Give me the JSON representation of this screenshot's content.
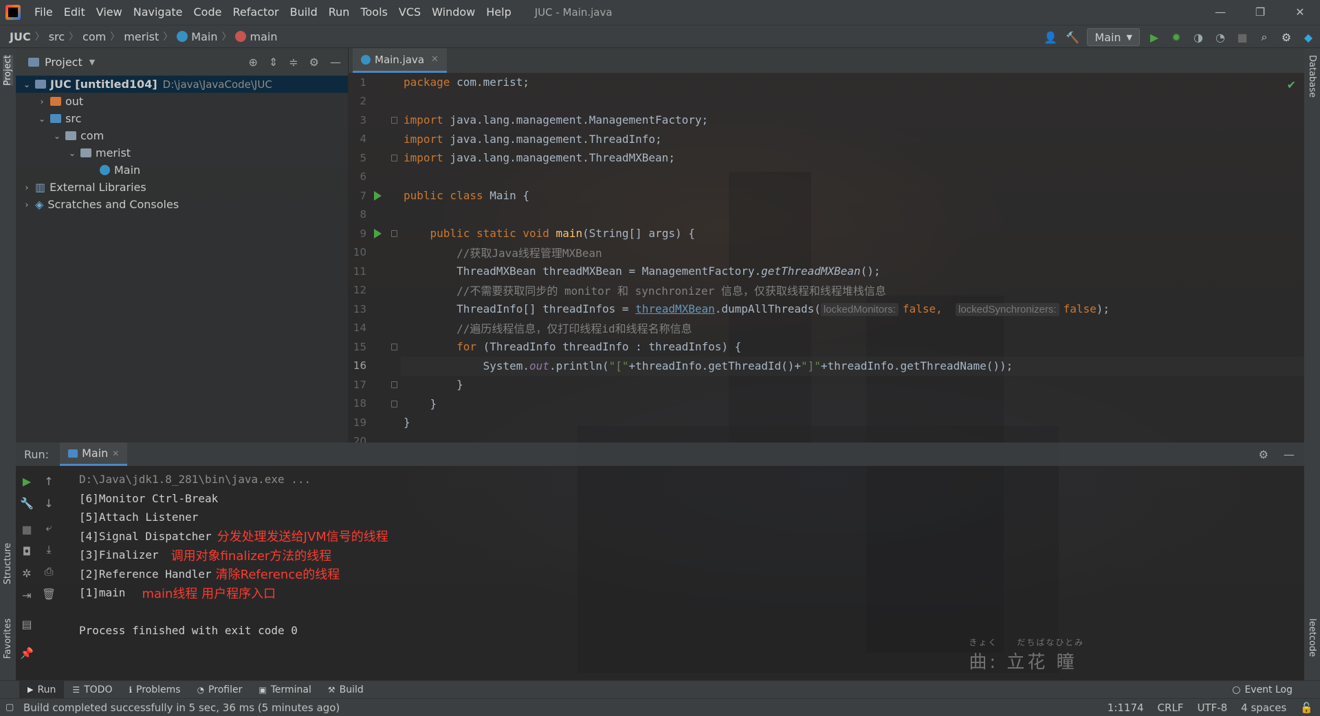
{
  "window": {
    "title": "JUC - Main.java",
    "menu": [
      "File",
      "Edit",
      "View",
      "Navigate",
      "Code",
      "Refactor",
      "Build",
      "Run",
      "Tools",
      "VCS",
      "Window",
      "Help"
    ],
    "controls": [
      "—",
      "❐",
      "✕"
    ]
  },
  "breadcrumb": [
    "JUC",
    "src",
    "com",
    "merist",
    "Main",
    "main"
  ],
  "toolbar": {
    "run_config": "Main"
  },
  "project": {
    "header": "Project",
    "tree": [
      {
        "label": "JUC [untitled104]",
        "path": "D:\\java\\JavaCode\\JUC"
      },
      {
        "label": "out",
        "path": ""
      },
      {
        "label": "src",
        "path": ""
      },
      {
        "label": "com",
        "path": ""
      },
      {
        "label": "merist",
        "path": ""
      },
      {
        "label": "Main",
        "path": ""
      },
      {
        "label": "External Libraries",
        "path": ""
      },
      {
        "label": "Scratches and Consoles",
        "path": ""
      }
    ]
  },
  "editor": {
    "tab": "Main.java",
    "line_numbers": [
      "1",
      "2",
      "3",
      "4",
      "5",
      "6",
      "7",
      "8",
      "9",
      "10",
      "11",
      "12",
      "13",
      "14",
      "15",
      "16",
      "17",
      "18",
      "19",
      "20"
    ],
    "current_line": "16",
    "lines": {
      "l1a": "package",
      "l1b": " com.merist;",
      "l3a": "import",
      "l3b": " java.lang.management.ManagementFactory;",
      "l4a": "import",
      "l4b": " java.lang.management.ThreadInfo;",
      "l5a": "import",
      "l5b": " java.lang.management.ThreadMXBean;",
      "l7a": "public class",
      "l7b": " Main {",
      "l9a": "    public static void",
      "l9b": " main",
      "l9c": "(String[] args) {",
      "l10": "        //获取Java线程管理MXBean",
      "l11a": "        ThreadMXBean threadMXBean = ManagementFactory.",
      "l11b": "getThreadMXBean",
      "l11c": "();",
      "l12": "        //不需要获取同步的 monitor 和 synchronizer 信息，仅获取线程和线程堆栈信息",
      "l13a": "        ThreadInfo[] threadInfos = ",
      "l13b": "threadMXBean",
      "l13c": ".dumpAllThreads(",
      "l13h1": "lockedMonitors:",
      "l13d": "false",
      "l13e": ",  ",
      "l13h2": "lockedSynchronizers:",
      "l13f": "false",
      "l13g": ");",
      "l14": "        //遍历线程信息，仅打印线程id和线程名称信息",
      "l15a": "        for",
      "l15b": " (ThreadInfo threadInfo : threadInfos) {",
      "l16a": "            System.",
      "l16b": "out",
      "l16c": ".println(",
      "l16d": "\"[\"",
      "l16e": "+threadInfo.getThreadId()+",
      "l16f": "\"]\"",
      "l16g": "+threadInfo.getThreadName());",
      "l17": "        }",
      "l18": "    }",
      "l19": "}"
    }
  },
  "run": {
    "label": "Run:",
    "tab": "Main",
    "console": [
      {
        "text": "D:\\Java\\jdk1.8_281\\bin\\java.exe ...",
        "note": ""
      },
      {
        "text": "[6]Monitor Ctrl-Break",
        "note": ""
      },
      {
        "text": "[5]Attach Listener",
        "note": ""
      },
      {
        "text": "[4]Signal Dispatcher",
        "note": "分发处理发送给JVM信号的线程"
      },
      {
        "text": "[3]Finalizer",
        "note": "调用对象finalizer方法的线程"
      },
      {
        "text": "[2]Reference Handler",
        "note": "清除Reference的线程"
      },
      {
        "text": "[1]main",
        "note": "main线程 用户程序入口"
      },
      {
        "text": "",
        "note": ""
      },
      {
        "text": "Process finished with exit code 0",
        "note": ""
      }
    ],
    "watermark_small": "きょく　　だちばなひとみ",
    "watermark_big": "曲: 立花 瞳"
  },
  "bottom_tabs": [
    "Run",
    "TODO",
    "Problems",
    "Profiler",
    "Terminal",
    "Build"
  ],
  "event_log": "Event Log",
  "side_labels": {
    "project": "Project",
    "structure": "Structure",
    "favorites": "Favorites",
    "database": "Database",
    "leetcode": "leetcode"
  },
  "status": {
    "message": "Build completed successfully in 5 sec, 36 ms (5 minutes ago)",
    "position": "1:1174",
    "line_sep": "CRLF",
    "encoding": "UTF-8",
    "indent": "4 spaces"
  },
  "colors": {
    "accent": "#4a88c7",
    "run_green": "#4ea344",
    "annotation_red": "#ff3b30"
  }
}
